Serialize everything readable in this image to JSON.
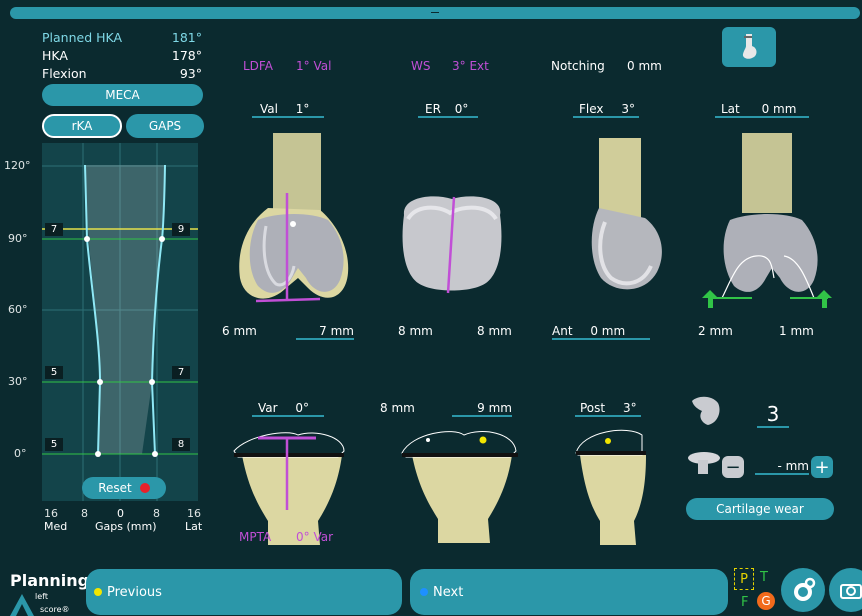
{
  "hka": {
    "rows": [
      {
        "label": "Planned HKA",
        "value": "181°"
      },
      {
        "label": "HKA",
        "value": "178°"
      },
      {
        "label": "Flexion",
        "value": "93°"
      }
    ]
  },
  "mode": {
    "meca": "MECA",
    "rka": "rKA",
    "gaps": "GAPS"
  },
  "graph": {
    "y_ticks": [
      "120°",
      "90°",
      "60°",
      "30°",
      "0°"
    ],
    "badges_left": [
      "7",
      "5",
      "5"
    ],
    "badges_right": [
      "9",
      "7",
      "8"
    ],
    "reset_label": "Reset",
    "x_ticks": [
      "16",
      "8",
      "0",
      "8",
      "16"
    ],
    "x_left": "Med",
    "x_center": "Gaps (mm)",
    "x_right": "Lat"
  },
  "top_metrics": {
    "ldfa_label": "LDFA",
    "ldfa_value": "1° Val",
    "ws_label": "WS",
    "ws_value": "3° Ext",
    "notching_label": "Notching",
    "notching_value": "0 mm"
  },
  "femur_row": {
    "val_label": "Val",
    "val_value": "1°",
    "er_label": "ER",
    "er_value": "0°",
    "flex_label": "Flex",
    "flex_value": "3°",
    "lat_label": "Lat",
    "lat_value": "0 mm"
  },
  "gap_row": {
    "a_left": "6 mm",
    "a_right": "7 mm",
    "b_left": "8 mm",
    "b_right": "8 mm",
    "ant_label": "Ant",
    "ant_value": "0 mm",
    "d_left": "2 mm",
    "d_right": "1 mm"
  },
  "tibia_row": {
    "var_label": "Var",
    "var_value": "0°",
    "e_left": "8 mm",
    "e_right": "9 mm",
    "post_label": "Post",
    "post_value": "3°"
  },
  "bottom_metric": {
    "mpta_label": "MPTA",
    "mpta_value": "0° Var"
  },
  "implant": {
    "size_value": "3",
    "thickness_value": "- mm",
    "cartilage_label": "Cartilage wear"
  },
  "footer": {
    "planning_label": "Planning",
    "side_label": "left",
    "brand_label": "score®",
    "previous_label": "Previous",
    "next_label": "Next",
    "pftg": {
      "p": "P",
      "t": "T",
      "f": "F",
      "g": "G"
    }
  },
  "colors": {
    "accent": "#2b97a9",
    "bg": "#0b2a2f",
    "purple": "#c14fd6",
    "yellow": "#f2e600",
    "blue": "#1e90ff",
    "green": "#31c447",
    "red": "#e8202a",
    "orange": "#f26a1b"
  },
  "icons": [
    "knee-view-icon",
    "cartilage-icon",
    "spacer-icon",
    "minus-icon",
    "plus-icon",
    "gear-icon",
    "camera-icon"
  ]
}
